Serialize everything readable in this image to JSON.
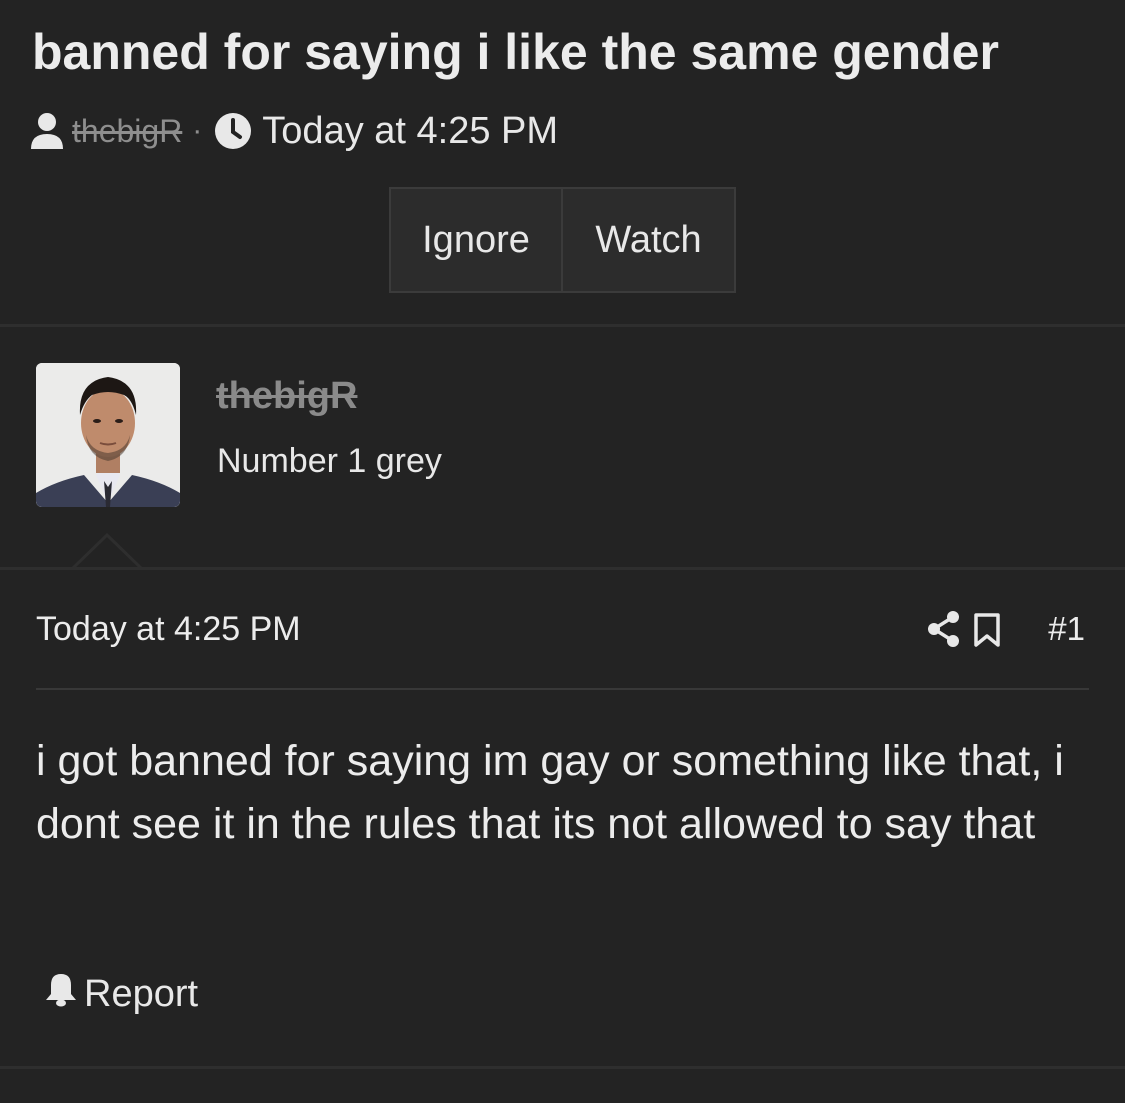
{
  "thread": {
    "title": "banned for saying i like the same gender",
    "author": "thebigR",
    "separator": "·",
    "time": "Today at 4:25 PM",
    "buttons": {
      "ignore": "Ignore",
      "watch": "Watch"
    }
  },
  "post": {
    "author": "thebigR",
    "author_title": "Number 1 grey",
    "date": "Today at 4:25 PM",
    "number": "#1",
    "text": "i got banned for saying im gay or something like that, i dont see it in the rules that its not allowed to say that",
    "report_label": "Report"
  },
  "icons": {
    "author": "user-icon",
    "time": "clock-icon",
    "share": "share-icon",
    "bookmark": "bookmark-icon",
    "report": "bell-icon"
  },
  "colors": {
    "background": "#232323",
    "text": "#ececec",
    "muted": "#8e8e8e",
    "button_bg": "#2c2c2c"
  }
}
